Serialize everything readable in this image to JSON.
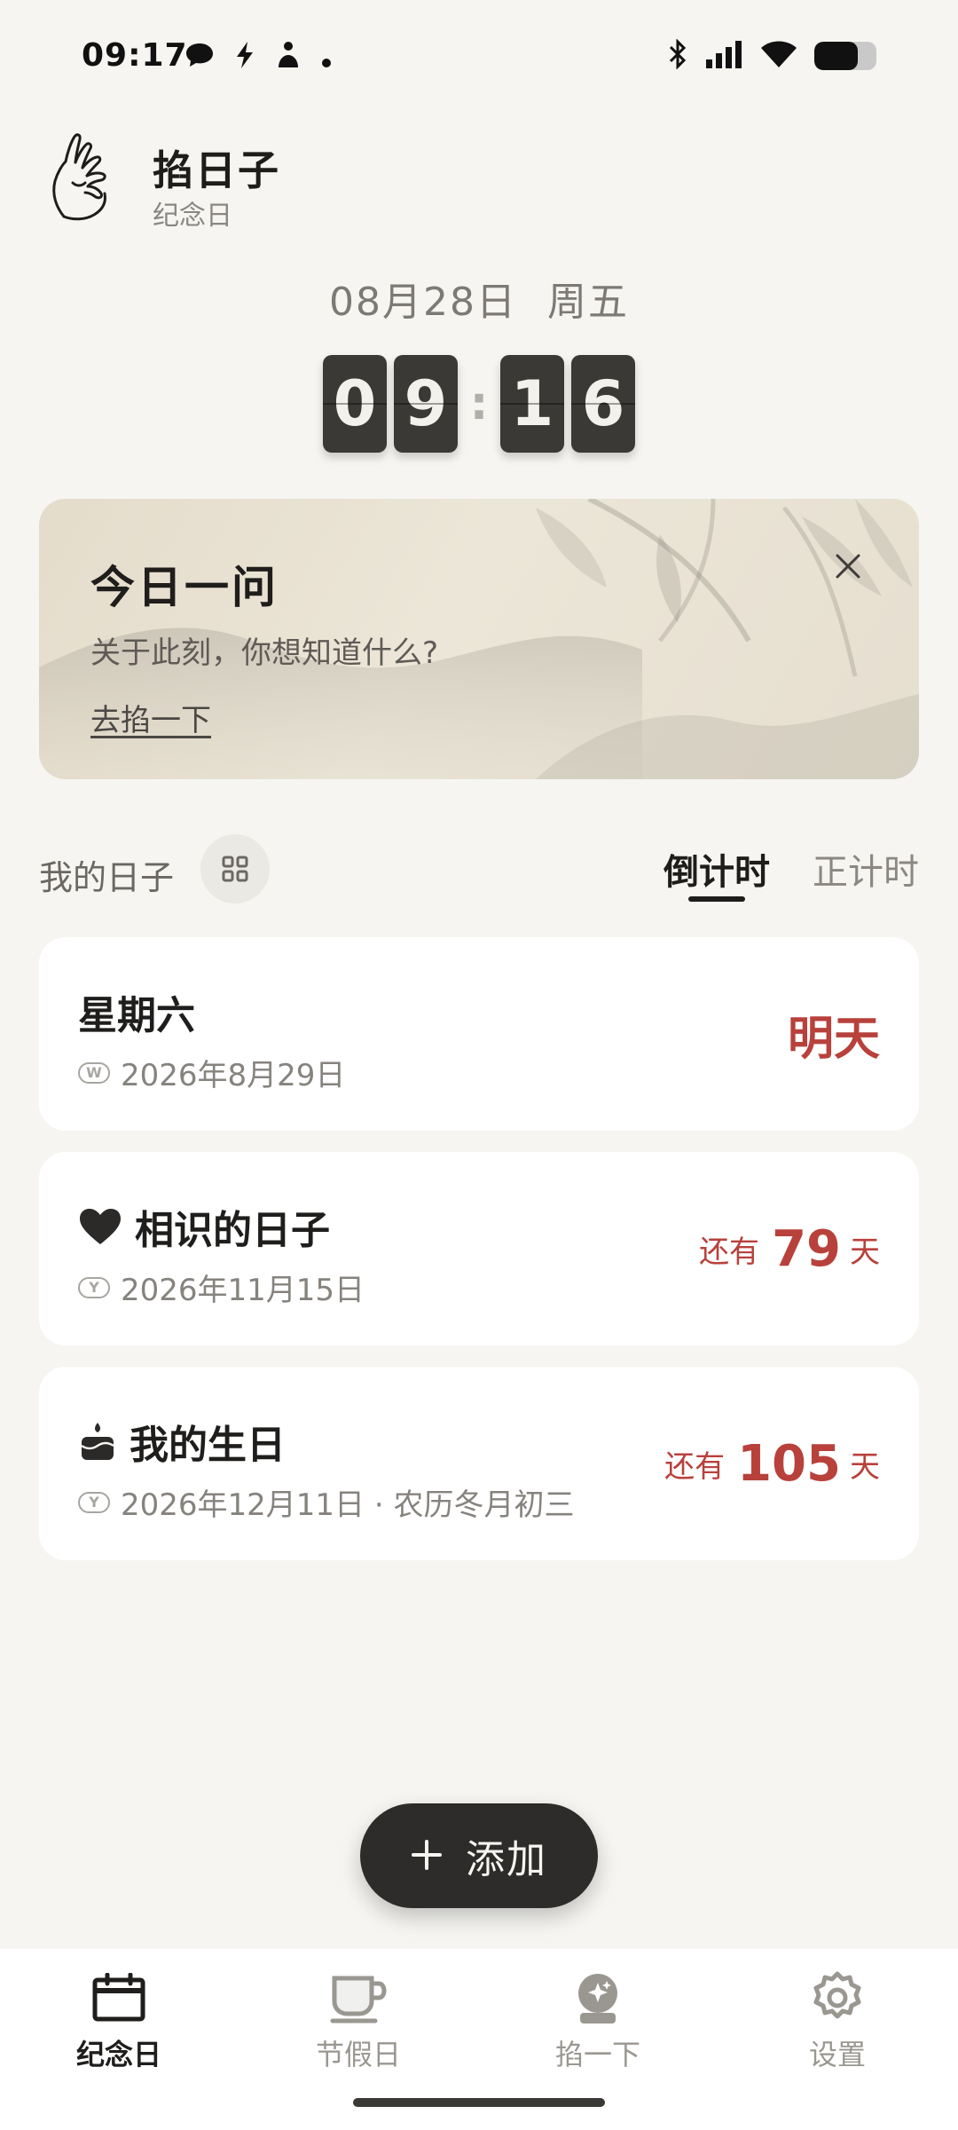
{
  "status_bar": {
    "time": "09:17",
    "left_icons": [
      "message-icon",
      "bolt-icon",
      "app-icon",
      "dot-icon"
    ],
    "right_icons": [
      "bluetooth-icon",
      "signal-icon",
      "wifi-icon",
      "battery-icon"
    ],
    "battery_level": 0.7
  },
  "header": {
    "title": "掐日子",
    "subtitle": "纪念日",
    "logo": "hand-mudra-icon"
  },
  "clock": {
    "date": "08月28日",
    "weekday": "周五",
    "hour_tens": "0",
    "hour_ones": "9",
    "separator": ":",
    "minute_tens": "1",
    "minute_ones": "6"
  },
  "question_card": {
    "title": "今日一问",
    "text": "关于此刻，你想知道什么?",
    "link": "去掐一下",
    "close_icon": "close-icon"
  },
  "section": {
    "label": "我的日子",
    "grid_icon": "grid-icon",
    "tabs": [
      {
        "label": "倒计时",
        "active": true
      },
      {
        "label": "正计时",
        "active": false
      }
    ]
  },
  "days": [
    {
      "title": "星期六",
      "icon": "",
      "tag": "W",
      "date": "2026年8月29日",
      "status": "明天"
    },
    {
      "title": "相识的日子",
      "icon": "heart-icon",
      "tag": "Y",
      "date": "2026年11月15日",
      "prefix": "还有",
      "count": "79",
      "unit": "天"
    },
    {
      "title": "我的生日",
      "icon": "cake-icon",
      "tag": "Y",
      "date": "2026年12月11日 · 农历冬月初三",
      "prefix": "还有",
      "count": "105",
      "unit": "天"
    }
  ],
  "add_button": {
    "icon": "plus-icon",
    "label": "添加"
  },
  "bottom_nav": [
    {
      "label": "纪念日",
      "icon": "calendar-icon",
      "active": true
    },
    {
      "label": "节假日",
      "icon": "cup-icon",
      "active": false
    },
    {
      "label": "掐一下",
      "icon": "crystal-ball-icon",
      "active": false
    },
    {
      "label": "设置",
      "icon": "settings-icon",
      "active": false
    }
  ],
  "colors": {
    "accent_red": "#b8413c",
    "background": "#f6f5f1",
    "dark": "#2d2c2a"
  }
}
